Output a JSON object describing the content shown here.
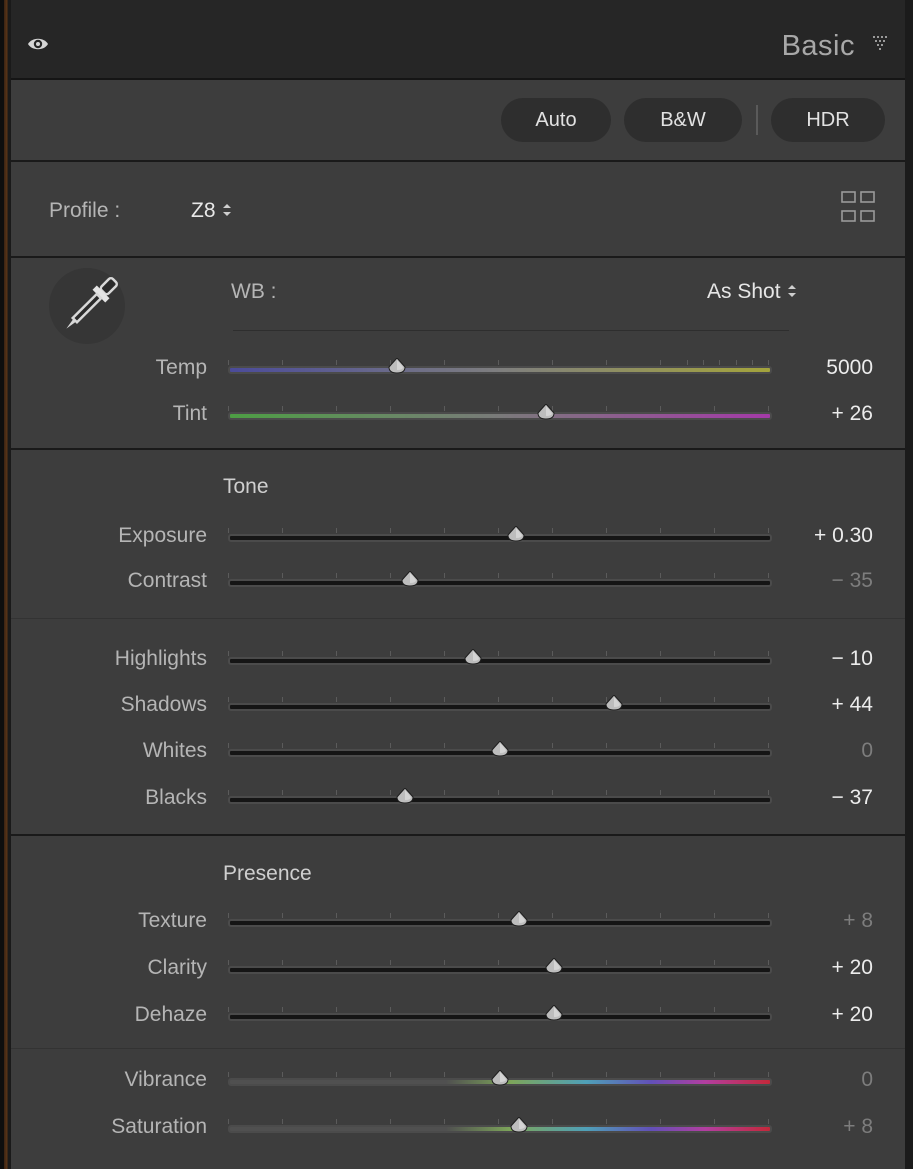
{
  "header": {
    "title": "Basic"
  },
  "treatment": {
    "auto": "Auto",
    "bw": "B&W",
    "hdr": "HDR"
  },
  "profile": {
    "label": "Profile :",
    "value": "Z8"
  },
  "wb": {
    "label": "WB :",
    "value": "As Shot",
    "sliders": [
      {
        "id": "temp",
        "label": "Temp",
        "value": "5000",
        "position": 0.31,
        "dim": false
      },
      {
        "id": "tint",
        "label": "Tint",
        "value": "+ 26",
        "position": 0.585,
        "dim": false
      }
    ]
  },
  "tone": {
    "header": "Tone",
    "sliders": [
      {
        "id": "exposure",
        "label": "Exposure",
        "value": "+ 0.30",
        "position": 0.53,
        "dim": false
      },
      {
        "id": "contrast",
        "label": "Contrast",
        "value": "− 35",
        "position": 0.335,
        "dim": true
      },
      {
        "id": "highlights",
        "label": "Highlights",
        "value": "− 10",
        "position": 0.45,
        "dim": false
      },
      {
        "id": "shadows",
        "label": "Shadows",
        "value": "+ 44",
        "position": 0.71,
        "dim": false
      },
      {
        "id": "whites",
        "label": "Whites",
        "value": "0",
        "position": 0.5,
        "dim": true
      },
      {
        "id": "blacks",
        "label": "Blacks",
        "value": "− 37",
        "position": 0.325,
        "dim": false
      }
    ]
  },
  "presence": {
    "header": "Presence",
    "sliders": [
      {
        "id": "texture",
        "label": "Texture",
        "value": "+ 8",
        "position": 0.535,
        "dim": true
      },
      {
        "id": "clarity",
        "label": "Clarity",
        "value": "+ 20",
        "position": 0.6,
        "dim": false
      },
      {
        "id": "dehaze",
        "label": "Dehaze",
        "value": "+ 20",
        "position": 0.6,
        "dim": false
      },
      {
        "id": "vibrance",
        "label": "Vibrance",
        "value": "0",
        "position": 0.5,
        "dim": true
      },
      {
        "id": "saturation",
        "label": "Saturation",
        "value": "+ 8",
        "position": 0.535,
        "dim": true
      }
    ]
  },
  "icons": [
    "eye-icon",
    "panel-collapse-icon",
    "profile-grid-icon",
    "eyedropper-icon",
    "up-down-arrows-icon",
    "slider-thumb-icon"
  ],
  "colors": {
    "panel": "#3d3d3d",
    "header": "#262626",
    "button": "#2e2e2e",
    "value": "#ececec",
    "value_dim": "#7d7d7d"
  }
}
